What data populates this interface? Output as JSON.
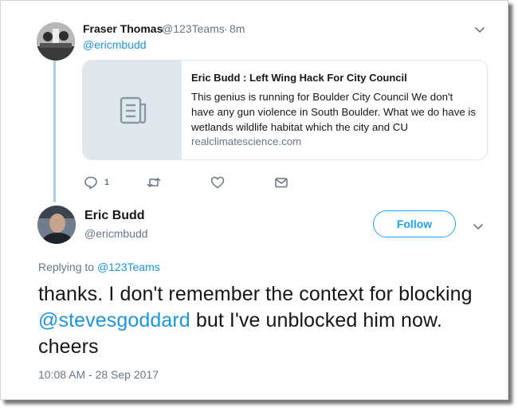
{
  "parent_tweet": {
    "display_name": "Fraser Thomas",
    "handle": "@123Teams",
    "separator": "·",
    "time": "8m",
    "mention": "@ericmbudd",
    "avatar_icon": "profile-photo",
    "menu_icon": "chevron-down-icon",
    "link_card": {
      "title": "Eric Budd : Left Wing Hack For City Council",
      "description": "This genius is running for Boulder City Council We don't have any gun violence in South Boulder. What we do have is wetlands wildlife habitat which the city and CU",
      "domain": "realclimatescience.com",
      "thumb_icon": "document-icon"
    },
    "actions": {
      "reply_count": "1",
      "reply_icon": "reply-icon",
      "retweet_icon": "retweet-icon",
      "like_icon": "heart-icon",
      "dm_icon": "envelope-icon"
    }
  },
  "main_tweet": {
    "display_name": "Eric Budd",
    "handle": "@ericmbudd",
    "follow_label": "Follow",
    "menu_icon": "chevron-down-icon",
    "replying_prefix": "Replying to",
    "replying_to": "@123Teams",
    "text_part1": "thanks. I don't remember the context for blocking",
    "text_mention": "@stevesgoddard",
    "text_part2": "but I've unblocked him now. cheers",
    "timestamp": "10:08 AM - 28 Sep 2017"
  },
  "colors": {
    "link": "#1b95e0",
    "accent": "#1da1f2",
    "muted": "#657786",
    "thread_line": "#a9cfe8",
    "card_border": "#e1e8ed"
  }
}
